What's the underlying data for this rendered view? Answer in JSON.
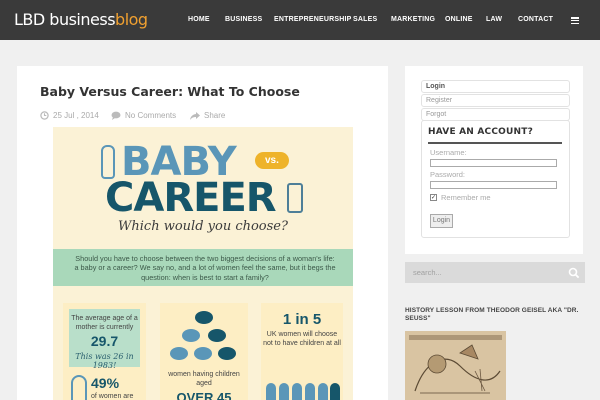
{
  "site": {
    "logo_main": "LBD business",
    "logo_accent": "blog"
  },
  "nav": {
    "items": [
      "HOME",
      "BUSINESS",
      "ENTREPRENEURSHIP",
      "SALES",
      "MARKETING",
      "ONLINE",
      "LAW",
      "CONTACT"
    ],
    "menu_icon": "hamburger-menu-icon"
  },
  "post": {
    "title": "Baby Versus Career: What To Choose",
    "date": "25 Jul , 2014",
    "comments": "No Comments",
    "share": "Share"
  },
  "infographic": {
    "word1": "BABY",
    "vs": "vs.",
    "word2": "CAREER",
    "question": "Which would you choose?",
    "intro": "Should you have to choose between the two biggest decisions of a woman's life: a baby or a career? We say no, and a lot of women feel the same, but it begs the question: when is best to start a family?",
    "stat1_label": "The average age of a mother is currently",
    "stat1_value": "29.7",
    "stat1_note": "This was 26 in 1983!",
    "stat2_value": "49%",
    "stat2_label": "of women are",
    "stat3_label": "women having children aged",
    "stat3_value": "OVER 45",
    "stat4_value": "1 in 5",
    "stat4_label": "UK women will choose not to have children at all"
  },
  "sidebar": {
    "tabs": [
      "Login",
      "Register",
      "Forgot"
    ],
    "login_title": "HAVE AN ACCOUNT?",
    "username_label": "Username:",
    "password_label": "Password:",
    "remember_label": "Remember me",
    "remember_checked": true,
    "login_button": "Login",
    "search_placeholder": "search...",
    "history_title": "HISTORY LESSON FROM THEODOR GEISEL AKA \"DR. SEUSS\""
  },
  "colors": {
    "topbar": "#3a3a3a",
    "logo_accent": "#f0a030",
    "infographic_bg": "#fbf2d6",
    "baby_blue": "#5a96b8",
    "career_teal": "#16566a",
    "mint": "#a9d8ba",
    "vs_yellow": "#eeb32a"
  }
}
